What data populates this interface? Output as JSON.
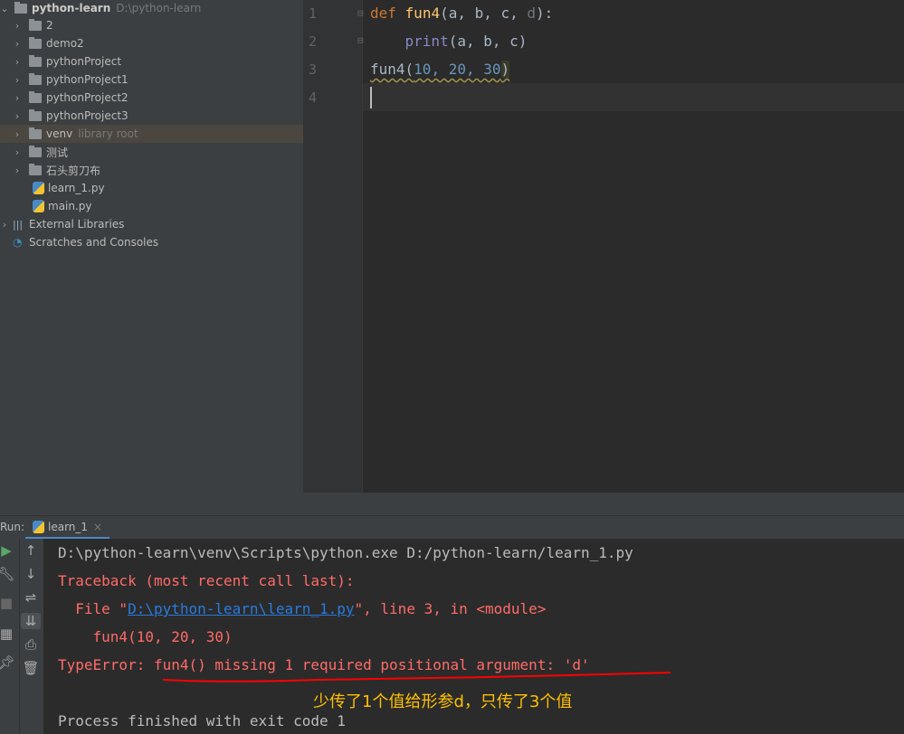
{
  "project": {
    "name": "python-learn",
    "path": "D:\\python-learn",
    "items": [
      {
        "type": "folder",
        "label": "2"
      },
      {
        "type": "folder",
        "label": "demo2"
      },
      {
        "type": "folder",
        "label": "pythonProject"
      },
      {
        "type": "folder",
        "label": "pythonProject1"
      },
      {
        "type": "folder",
        "label": "pythonProject2"
      },
      {
        "type": "folder",
        "label": "pythonProject3"
      },
      {
        "type": "folder",
        "label": "venv",
        "hint": "library root"
      },
      {
        "type": "folder",
        "label": "测试"
      },
      {
        "type": "folder",
        "label": "石头剪刀布"
      },
      {
        "type": "file",
        "label": "learn_1.py"
      },
      {
        "type": "file",
        "label": "main.py"
      }
    ],
    "external": "External Libraries",
    "scratches": "Scratches and Consoles"
  },
  "editor": {
    "line_numbers": [
      "1",
      "2",
      "3",
      "4"
    ],
    "code": {
      "l1_def": "def",
      "l1_name": "fun4",
      "l1_open": "(a, b, c, ",
      "l1_d": "d",
      "l1_close": "):",
      "l2": "    print",
      "l2_args": "(a, b, c)",
      "l3_name": "fun4(",
      "l3_args": "10, 20, 30",
      "l3_close": ")"
    }
  },
  "run": {
    "label": "Run:",
    "tab": "learn_1",
    "console": {
      "cmd": "D:\\python-learn\\venv\\Scripts\\python.exe D:/python-learn/learn_1.py",
      "traceback": "Traceback (most recent call last):",
      "file_prefix": "  File \"",
      "file_link": "D:\\python-learn\\learn_1.py",
      "file_suffix": "\", line 3, in <module>",
      "code_line": "    fun4(10, 20, 30)",
      "error_prefix": "TypeError: ",
      "error_msg": "fun4() missing 1 required positional argument: 'd'",
      "exit": "Process finished with exit code 1"
    },
    "annotation": "少传了1个值给形参d，只传了3个值"
  },
  "colors": {
    "error": "#ff6b68",
    "annotation": "#ffc000",
    "underline": "#ff0000",
    "link": "#287bde"
  }
}
